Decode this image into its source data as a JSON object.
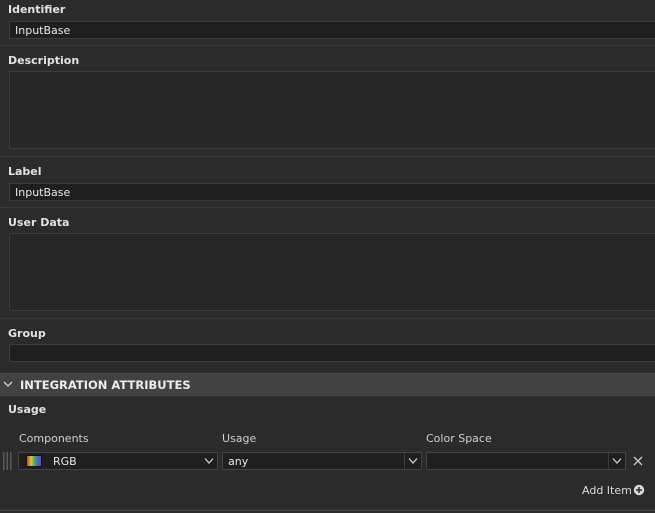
{
  "properties": {
    "identifier": {
      "label": "Identifier",
      "value": "InputBase"
    },
    "description": {
      "label": "Description",
      "value": ""
    },
    "label": {
      "label": "Label",
      "value": "InputBase"
    },
    "user_data": {
      "label": "User Data",
      "value": ""
    },
    "group": {
      "label": "Group",
      "value": ""
    }
  },
  "integration": {
    "section_title": "INTEGRATION ATTRIBUTES",
    "usage_label": "Usage",
    "columns": {
      "components": "Components",
      "usage": "Usage",
      "color_space": "Color Space"
    },
    "row": {
      "components": "RGB",
      "usage": "any",
      "color_space": ""
    },
    "add_item_label": "Add Item"
  },
  "icons": [
    "chevron-down-icon",
    "dropdown-arrow-icon",
    "close-icon",
    "add-circle-icon",
    "drag-handle-icon",
    "color-swatch-icon"
  ]
}
